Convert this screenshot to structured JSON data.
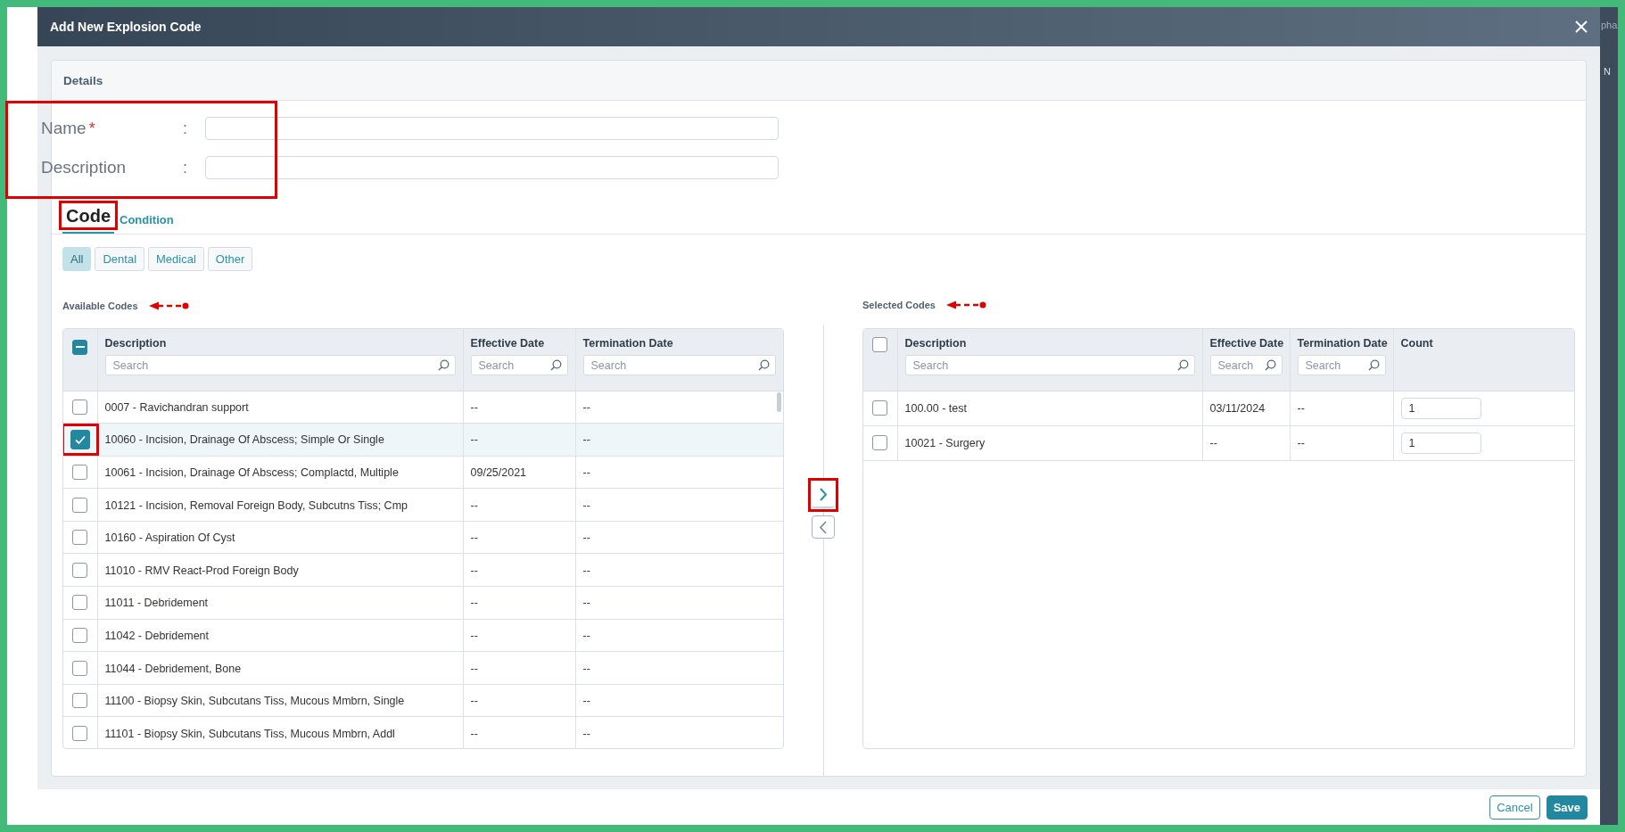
{
  "window": {
    "title": "Add New Explosion Code"
  },
  "background_text": [
    "pha",
    "N"
  ],
  "details": {
    "title": "Details",
    "highlighted": true,
    "fields": [
      {
        "label": "Name",
        "colon": ":",
        "required_mark": "*"
      },
      {
        "label": "Description",
        "colon": ":"
      }
    ]
  },
  "tabs": [
    {
      "label": "Code",
      "selected": true,
      "highlighted": true
    },
    {
      "label": "Condition",
      "selected": false,
      "highlighted": false
    }
  ],
  "filters": [
    {
      "label": "All",
      "selected": true
    },
    {
      "label": "Dental",
      "selected": false
    },
    {
      "label": "Medical",
      "selected": false
    },
    {
      "label": "Other",
      "selected": false
    }
  ],
  "available": {
    "title": "Available Codes",
    "arrow": true,
    "select_all": {
      "indeterminate": true
    },
    "columns": [
      {
        "label": "Description",
        "placeholder": "Search"
      },
      {
        "label": "Effective Date",
        "placeholder": "Search"
      },
      {
        "label": "Termination Date",
        "placeholder": "Search"
      }
    ],
    "rows": [
      {
        "checked": false,
        "highlighted": false,
        "cells": [
          "0007 - Ravichandran support",
          "--",
          "--"
        ]
      },
      {
        "checked": true,
        "highlighted": true,
        "cells": [
          "10060 - Incision, Drainage Of Abscess; Simple Or Single",
          "--",
          "--"
        ]
      },
      {
        "checked": false,
        "highlighted": false,
        "cells": [
          "10061 - Incision, Drainage Of Abscess; Complactd, Multiple",
          "09/25/2021",
          "--"
        ]
      },
      {
        "checked": false,
        "highlighted": false,
        "cells": [
          "10121 - Incision, Removal Foreign Body, Subcutns Tiss; Cmp",
          "--",
          "--"
        ]
      },
      {
        "checked": false,
        "highlighted": false,
        "cells": [
          "10160 - Aspiration Of Cyst",
          "--",
          "--"
        ]
      },
      {
        "checked": false,
        "highlighted": false,
        "cells": [
          "11010 - RMV React-Prod Foreign Body",
          "--",
          "--"
        ]
      },
      {
        "checked": false,
        "highlighted": false,
        "cells": [
          "11011 - Debridement",
          "--",
          "--"
        ]
      },
      {
        "checked": false,
        "highlighted": false,
        "cells": [
          "11042 - Debridement",
          "--",
          "--"
        ]
      },
      {
        "checked": false,
        "highlighted": false,
        "cells": [
          "11044 - Debridement, Bone",
          "--",
          "--"
        ]
      },
      {
        "checked": false,
        "highlighted": false,
        "cells": [
          "11100 - Biopsy Skin, Subcutans Tiss, Mucous Mmbrn, Single",
          "--",
          "--"
        ]
      },
      {
        "checked": false,
        "highlighted": false,
        "cells": [
          "11101 - Biopsy Skin, Subcutans Tiss, Mucous Mmbrn, Addl",
          "--",
          "--"
        ]
      }
    ]
  },
  "transfer": [
    {
      "kind": "right",
      "highlighted": true
    },
    {
      "kind": "left",
      "highlighted": false
    }
  ],
  "selected": {
    "title": "Selected Codes",
    "arrow": true,
    "select_all": {
      "checked": false,
      "indeterminate": false
    },
    "columns": [
      {
        "label": "Description",
        "placeholder": "Search"
      },
      {
        "label": "Effective Date",
        "placeholder": "Search"
      },
      {
        "label": "Termination Date",
        "placeholder": "Search"
      },
      {
        "label": "Count"
      }
    ],
    "rows": [
      {
        "checked": false,
        "highlighted": false,
        "cells": [
          "100.00 - test",
          "03/11/2024",
          "--"
        ],
        "count": "1"
      },
      {
        "checked": false,
        "highlighted": false,
        "cells": [
          "10021 - Surgery",
          "--",
          "--"
        ],
        "count": "1"
      }
    ]
  },
  "footer": {
    "buttons": [
      {
        "label": "Cancel",
        "kind": "secondary"
      },
      {
        "label": "Save",
        "kind": "primary"
      }
    ]
  }
}
